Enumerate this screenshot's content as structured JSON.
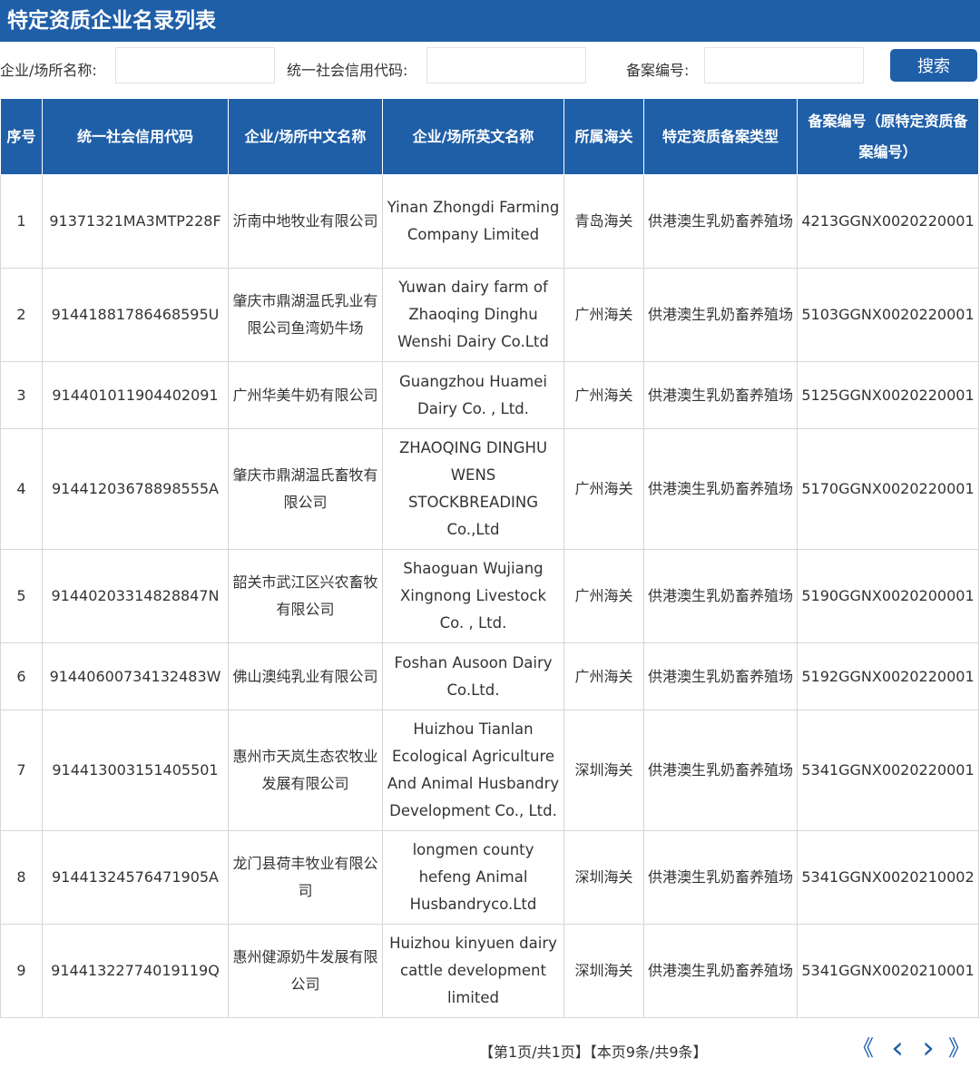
{
  "page": {
    "title": "特定资质企业名录列表"
  },
  "search": {
    "name_label": "企业/场所名称:",
    "code_label": "统一社会信用代码:",
    "record_label": "备案编号:",
    "name_value": "",
    "code_value": "",
    "record_value": "",
    "button_label": "搜索"
  },
  "table": {
    "headers": [
      "序号",
      "统一社会信用代码",
      "企业/场所中文名称",
      "企业/场所英文名称",
      "所属海关",
      "特定资质备案类型",
      "备案编号（原特定资质备案编号）"
    ],
    "rows": [
      {
        "no": "1",
        "code": "91371321MA3MTP228F",
        "cn": "沂南中地牧业有限公司",
        "en": "Yinan Zhongdi Farming Company Limited",
        "customs": "青岛海关",
        "type": "供港澳生乳奶畜养殖场",
        "record": "4213GGNX0020220001"
      },
      {
        "no": "2",
        "code": "91441881786468595U",
        "cn": "肇庆市鼎湖温氏乳业有限公司鱼湾奶牛场",
        "en": "Yuwan dairy farm of Zhaoqing Dinghu Wenshi Dairy Co.Ltd",
        "customs": "广州海关",
        "type": "供港澳生乳奶畜养殖场",
        "record": "5103GGNX0020220001"
      },
      {
        "no": "3",
        "code": "914401011904402091",
        "cn": "广州华美牛奶有限公司",
        "en": "Guangzhou Huamei Dairy Co. , Ltd.",
        "customs": "广州海关",
        "type": "供港澳生乳奶畜养殖场",
        "record": "5125GGNX0020220001"
      },
      {
        "no": "4",
        "code": "91441203678898555A",
        "cn": "肇庆市鼎湖温氏畜牧有限公司",
        "en": "ZHAOQING DINGHU WENS STOCKBREADING Co.,Ltd",
        "customs": "广州海关",
        "type": "供港澳生乳奶畜养殖场",
        "record": "5170GGNX0020220001"
      },
      {
        "no": "5",
        "code": "91440203314828847N",
        "cn": "韶关市武江区兴农畜牧有限公司",
        "en": "Shaoguan Wujiang Xingnong Livestock Co. , Ltd.",
        "customs": "广州海关",
        "type": "供港澳生乳奶畜养殖场",
        "record": "5190GGNX0020200001"
      },
      {
        "no": "6",
        "code": "91440600734132483W",
        "cn": "佛山澳纯乳业有限公司",
        "en": "Foshan Ausoon Dairy Co.Ltd.",
        "customs": "广州海关",
        "type": "供港澳生乳奶畜养殖场",
        "record": "5192GGNX0020220001"
      },
      {
        "no": "7",
        "code": "914413003151405501",
        "cn": "惠州市天岚生态农牧业发展有限公司",
        "en": "Huizhou Tianlan Ecological Agriculture And Animal Husbandry Development Co., Ltd.",
        "customs": "深圳海关",
        "type": "供港澳生乳奶畜养殖场",
        "record": "5341GGNX0020220001"
      },
      {
        "no": "8",
        "code": "91441324576471905A",
        "cn": "龙门县荷丰牧业有限公司",
        "en": "longmen county hefeng Animal Husbandryco.Ltd",
        "customs": "深圳海关",
        "type": "供港澳生乳奶畜养殖场",
        "record": "5341GGNX0020210002"
      },
      {
        "no": "9",
        "code": "91441322774019119Q",
        "cn": "惠州健源奶牛发展有限公司",
        "en": "Huizhou kinyuen dairy cattle development limited",
        "customs": "深圳海关",
        "type": "供港澳生乳奶畜养殖场",
        "record": "5341GGNX0020210001"
      }
    ]
  },
  "pager": {
    "info": "【第1页/共1页】【本页9条/共9条】",
    "first": "《",
    "prev": "‹",
    "next": "›",
    "last": "》"
  }
}
